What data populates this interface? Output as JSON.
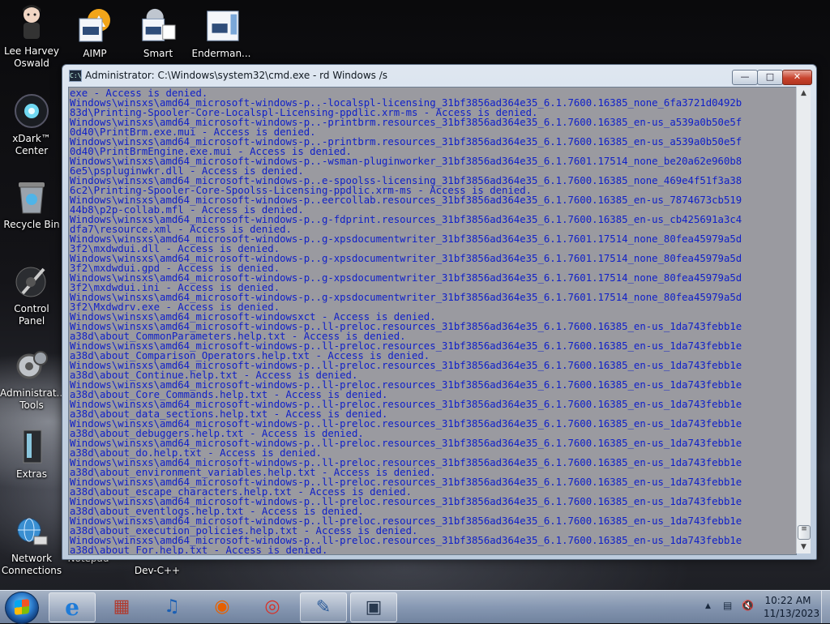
{
  "desktop": {
    "icons": [
      {
        "label": "Lee Harvey Oswald",
        "icon": "character-icon"
      },
      {
        "label": "AIMP",
        "icon": "aimp-icon"
      },
      {
        "label": "Smart",
        "icon": "smart-icon"
      },
      {
        "label": "Enderman...",
        "icon": "program-icon"
      },
      {
        "label": "xDark™ Center",
        "icon": "xdark-icon"
      },
      {
        "label": "Recycle Bin",
        "icon": "recycle-bin-icon"
      },
      {
        "label": "Control Panel",
        "icon": "control-panel-icon"
      },
      {
        "label": "Administrat... Tools",
        "icon": "admin-tools-icon"
      },
      {
        "label": "Extras",
        "icon": "extras-icon"
      },
      {
        "label": "Network Connections",
        "icon": "network-icon"
      },
      {
        "label": "Notepad",
        "icon": "notepad-label-partial"
      },
      {
        "label": "Dev-C++",
        "icon": "devcpp-label"
      }
    ]
  },
  "window": {
    "title": "Administrator: C:\\Windows\\system32\\cmd.exe - rd  Windows /s",
    "icon": "cmd-icon",
    "buttons": {
      "minimize": "—",
      "maximize": "□",
      "close": "✕"
    },
    "console_lines": [
      "exe - Access is denied.",
      "Windows\\winsxs\\amd64_microsoft-windows-p..-localspl-licensing_31bf3856ad364e35_6.1.7600.16385_none_6fa3721d0492b",
      "83d\\Printing-Spooler-Core-Localspl-Licensing-ppdlic.xrm-ms - Access is denied.",
      "Windows\\winsxs\\amd64_microsoft-windows-p..-printbrm.resources_31bf3856ad364e35_6.1.7600.16385_en-us_a539a0b50e5f",
      "0d40\\PrintBrm.exe.mui - Access is denied.",
      "Windows\\winsxs\\amd64_microsoft-windows-p..-printbrm.resources_31bf3856ad364e35_6.1.7600.16385_en-us_a539a0b50e5f",
      "0d40\\PrintBrmEngine.exe.mui - Access is denied.",
      "Windows\\winsxs\\amd64_microsoft-windows-p..-wsman-pluginworker_31bf3856ad364e35_6.1.7601.17514_none_be20a62e960b8",
      "6e5\\pspluginwkr.dll - Access is denied.",
      "Windows\\winsxs\\amd64_microsoft-windows-p..e-spoolss-licensing_31bf3856ad364e35_6.1.7600.16385_none_469e4f51f3a38",
      "6c2\\Printing-Spooler-Core-Spoolss-Licensing-ppdlic.xrm-ms - Access is denied.",
      "Windows\\winsxs\\amd64_microsoft-windows-p..eercollab.resources_31bf3856ad364e35_6.1.7600.16385_en-us_7874673cb519",
      "44b8\\p2p-collab.mfl - Access is denied.",
      "Windows\\winsxs\\amd64_microsoft-windows-p..g-fdprint.resources_31bf3856ad364e35_6.1.7600.16385_en-us_cb425691a3c4",
      "dfa7\\resource.xml - Access is denied.",
      "Windows\\winsxs\\amd64_microsoft-windows-p..g-xpsdocumentwriter_31bf3856ad364e35_6.1.7601.17514_none_80fea45979a5d",
      "3f2\\mxdwdui.dll - Access is denied.",
      "Windows\\winsxs\\amd64_microsoft-windows-p..g-xpsdocumentwriter_31bf3856ad364e35_6.1.7601.17514_none_80fea45979a5d",
      "3f2\\mxdwdui.gpd - Access is denied.",
      "Windows\\winsxs\\amd64_microsoft-windows-p..g-xpsdocumentwriter_31bf3856ad364e35_6.1.7601.17514_none_80fea45979a5d",
      "3f2\\mxdwdui.ini - Access is denied.",
      "Windows\\winsxs\\amd64_microsoft-windows-p..g-xpsdocumentwriter_31bf3856ad364e35_6.1.7601.17514_none_80fea45979a5d",
      "3f2\\Mxdwdrv.exe - Access is denied.",
      "Windows\\winsxs\\amd64_microsoft-windowsxct - Access is denied.",
      "Windows\\winsxs\\amd64_microsoft-windows-p..ll-preloc.resources_31bf3856ad364e35_6.1.7600.16385_en-us_1da743febb1e",
      "a38d\\about_CommonParameters.help.txt - Access is denied.",
      "Windows\\winsxs\\amd64_microsoft-windows-p..ll-preloc.resources_31bf3856ad364e35_6.1.7600.16385_en-us_1da743febb1e",
      "a38d\\about_Comparison_Operators.help.txt - Access is denied.",
      "Windows\\winsxs\\amd64_microsoft-windows-p..ll-preloc.resources_31bf3856ad364e35_6.1.7600.16385_en-us_1da743febb1e",
      "a38d\\about_Continue.help.txt - Access is denied.",
      "Windows\\winsxs\\amd64_microsoft-windows-p..ll-preloc.resources_31bf3856ad364e35_6.1.7600.16385_en-us_1da743febb1e",
      "a38d\\about_Core_Commands.help.txt - Access is denied.",
      "Windows\\winsxs\\amd64_microsoft-windows-p..ll-preloc.resources_31bf3856ad364e35_6.1.7600.16385_en-us_1da743febb1e",
      "a38d\\about_data_sections.help.txt - Access is denied.",
      "Windows\\winsxs\\amd64_microsoft-windows-p..ll-preloc.resources_31bf3856ad364e35_6.1.7600.16385_en-us_1da743febb1e",
      "a38d\\about_debuggers.help.txt - Access is denied.",
      "Windows\\winsxs\\amd64_microsoft-windows-p..ll-preloc.resources_31bf3856ad364e35_6.1.7600.16385_en-us_1da743febb1e",
      "a38d\\about_do.help.txt - Access is denied.",
      "Windows\\winsxs\\amd64_microsoft-windows-p..ll-preloc.resources_31bf3856ad364e35_6.1.7600.16385_en-us_1da743febb1e",
      "a38d\\about_environment_variables.help.txt - Access is denied.",
      "Windows\\winsxs\\amd64_microsoft-windows-p..ll-preloc.resources_31bf3856ad364e35_6.1.7600.16385_en-us_1da743febb1e",
      "a38d\\about_escape_characters.help.txt - Access is denied.",
      "Windows\\winsxs\\amd64_microsoft-windows-p..ll-preloc.resources_31bf3856ad364e35_6.1.7600.16385_en-us_1da743febb1e",
      "a38d\\about_eventlogs.help.txt - Access is denied.",
      "Windows\\winsxs\\amd64_microsoft-windows-p..ll-preloc.resources_31bf3856ad364e35_6.1.7600.16385_en-us_1da743febb1e",
      "a38d\\about_execution_policies.help.txt - Access is denied.",
      "Windows\\winsxs\\amd64_microsoft-windows-p..ll-preloc.resources_31bf3856ad364e35_6.1.7600.16385_en-us_1da743febb1e",
      "a38d\\about_For.help.txt - Access is denied."
    ]
  },
  "taskbar": {
    "items": [
      {
        "name": "internet-explorer-icon",
        "glyph": "e"
      },
      {
        "name": "library-icon",
        "glyph": "▦"
      },
      {
        "name": "music-player-icon",
        "glyph": "♫"
      },
      {
        "name": "firefox-icon",
        "glyph": "◉"
      },
      {
        "name": "chrome-icon",
        "glyph": "◎"
      },
      {
        "name": "tools-icon",
        "glyph": "✎"
      },
      {
        "name": "cmd-taskbar-icon",
        "glyph": "▣"
      }
    ],
    "clock": {
      "time": "10:22 AM",
      "date": "11/13/2023"
    },
    "tray": {
      "show_hidden": "▲",
      "network": "▤",
      "volume": "🔇"
    }
  }
}
